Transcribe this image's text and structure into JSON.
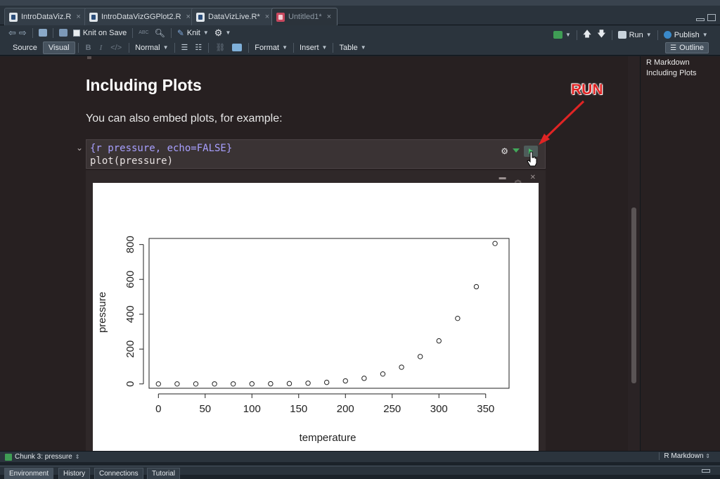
{
  "editor_tabs": [
    {
      "label": "IntroDataViz.R",
      "icon": "r-script-icon"
    },
    {
      "label": "IntroDataVizGGPlot2.R",
      "icon": "r-script-icon"
    },
    {
      "label": "DataVizLive.R*",
      "icon": "r-script-icon"
    },
    {
      "label": "Untitled1*",
      "icon": "r-markdown-icon",
      "active": true
    }
  ],
  "toolbar": {
    "knit_on_save": "Knit on Save",
    "knit": "Knit",
    "run": "Run",
    "publish": "Publish"
  },
  "format_bar": {
    "source": "Source",
    "visual": "Visual",
    "style": "Normal",
    "format": "Format",
    "insert": "Insert",
    "table": "Table",
    "outline": "Outline"
  },
  "document": {
    "heading": "Including Plots",
    "paragraph": "You can also embed plots, for example:",
    "chunk_header": "{r pressure, echo=FALSE}",
    "chunk_code": "plot(pressure)"
  },
  "annotation": {
    "label": "RUN",
    "color": "#e02424"
  },
  "outline_items": [
    "R Markdown",
    "Including Plots"
  ],
  "status": {
    "chunk": "Chunk 3: pressure",
    "mode": "R Markdown"
  },
  "bottom_tabs": [
    "Environment",
    "History",
    "Connections",
    "Tutorial"
  ],
  "chart_data": {
    "type": "scatter",
    "xlabel": "temperature",
    "ylabel": "pressure",
    "x": [
      0,
      20,
      40,
      60,
      80,
      100,
      120,
      140,
      160,
      180,
      200,
      220,
      240,
      260,
      280,
      300,
      320,
      340,
      360
    ],
    "y": [
      0.0002,
      0.0012,
      0.006,
      0.03,
      0.09,
      0.27,
      0.75,
      1.85,
      4.2,
      8.8,
      17.3,
      32.1,
      57,
      96,
      157,
      247,
      376,
      558,
      806
    ],
    "xticks": [
      0,
      50,
      100,
      150,
      200,
      250,
      300,
      350
    ],
    "yticks": [
      0,
      200,
      400,
      600,
      800
    ],
    "xlim": [
      -10,
      375
    ],
    "ylim": [
      -25,
      835
    ],
    "grid": false,
    "marker": "open-circle"
  }
}
